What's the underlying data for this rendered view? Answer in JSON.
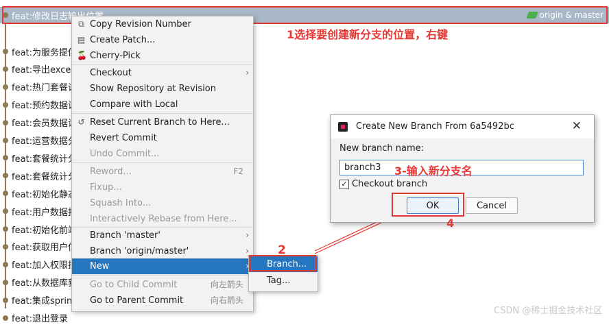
{
  "log": {
    "selected_message": "feat:修改日志输出位置",
    "selected_refs": "origin & master",
    "rows": [
      "feat:为服务提供",
      "feat:导出excel",
      "feat:热门套餐设",
      "feat:预约数据设",
      "feat:会员数据设",
      "feat:运营数据分",
      "feat:套餐统计分",
      "feat:套餐统计分",
      "feat:初始化静态",
      "feat:用户数据报",
      "feat:初始化前端",
      "feat:获取用户信",
      "feat:加入权限技",
      "feat:从数据库获",
      "feat:集成spring",
      "feat:退出登录"
    ]
  },
  "menu": {
    "copy_revision": "Copy Revision Number",
    "create_patch": "Create Patch...",
    "cherry_pick": "Cherry-Pick",
    "checkout": "Checkout",
    "show_repo": "Show Repository at Revision",
    "compare_local": "Compare with Local",
    "reset_branch": "Reset Current Branch to Here...",
    "revert_commit": "Revert Commit",
    "undo_commit": "Undo Commit...",
    "reword": "Reword...",
    "reword_shortcut": "F2",
    "fixup": "Fixup...",
    "squash": "Squash Into...",
    "interactive_rebase": "Interactively Rebase from Here...",
    "branch_master": "Branch 'master'",
    "branch_origin_master": "Branch 'origin/master'",
    "new": "New",
    "goto_child": "Go to Child Commit",
    "goto_child_shortcut": "向左箭头",
    "goto_parent": "Go to Parent Commit",
    "goto_parent_shortcut": "向右箭头"
  },
  "submenu": {
    "branch": "Branch...",
    "tag": "Tag..."
  },
  "dialog": {
    "title": "Create New Branch From 6a5492bc",
    "label": "New branch name:",
    "input_value": "branch3",
    "checkout_label": "Checkout branch",
    "ok_label": "OK",
    "cancel_label": "Cancel"
  },
  "annotations": {
    "step1": "1选择要创建新分支的位置，右键",
    "step2": "2",
    "step3": "3-输入新分支名",
    "step4": "4"
  },
  "watermark": "CSDN @稀土掘金技术社区",
  "colors": {
    "accent": "#2675bf",
    "annotation": "#e53935",
    "selection": "#a9b7c6"
  }
}
